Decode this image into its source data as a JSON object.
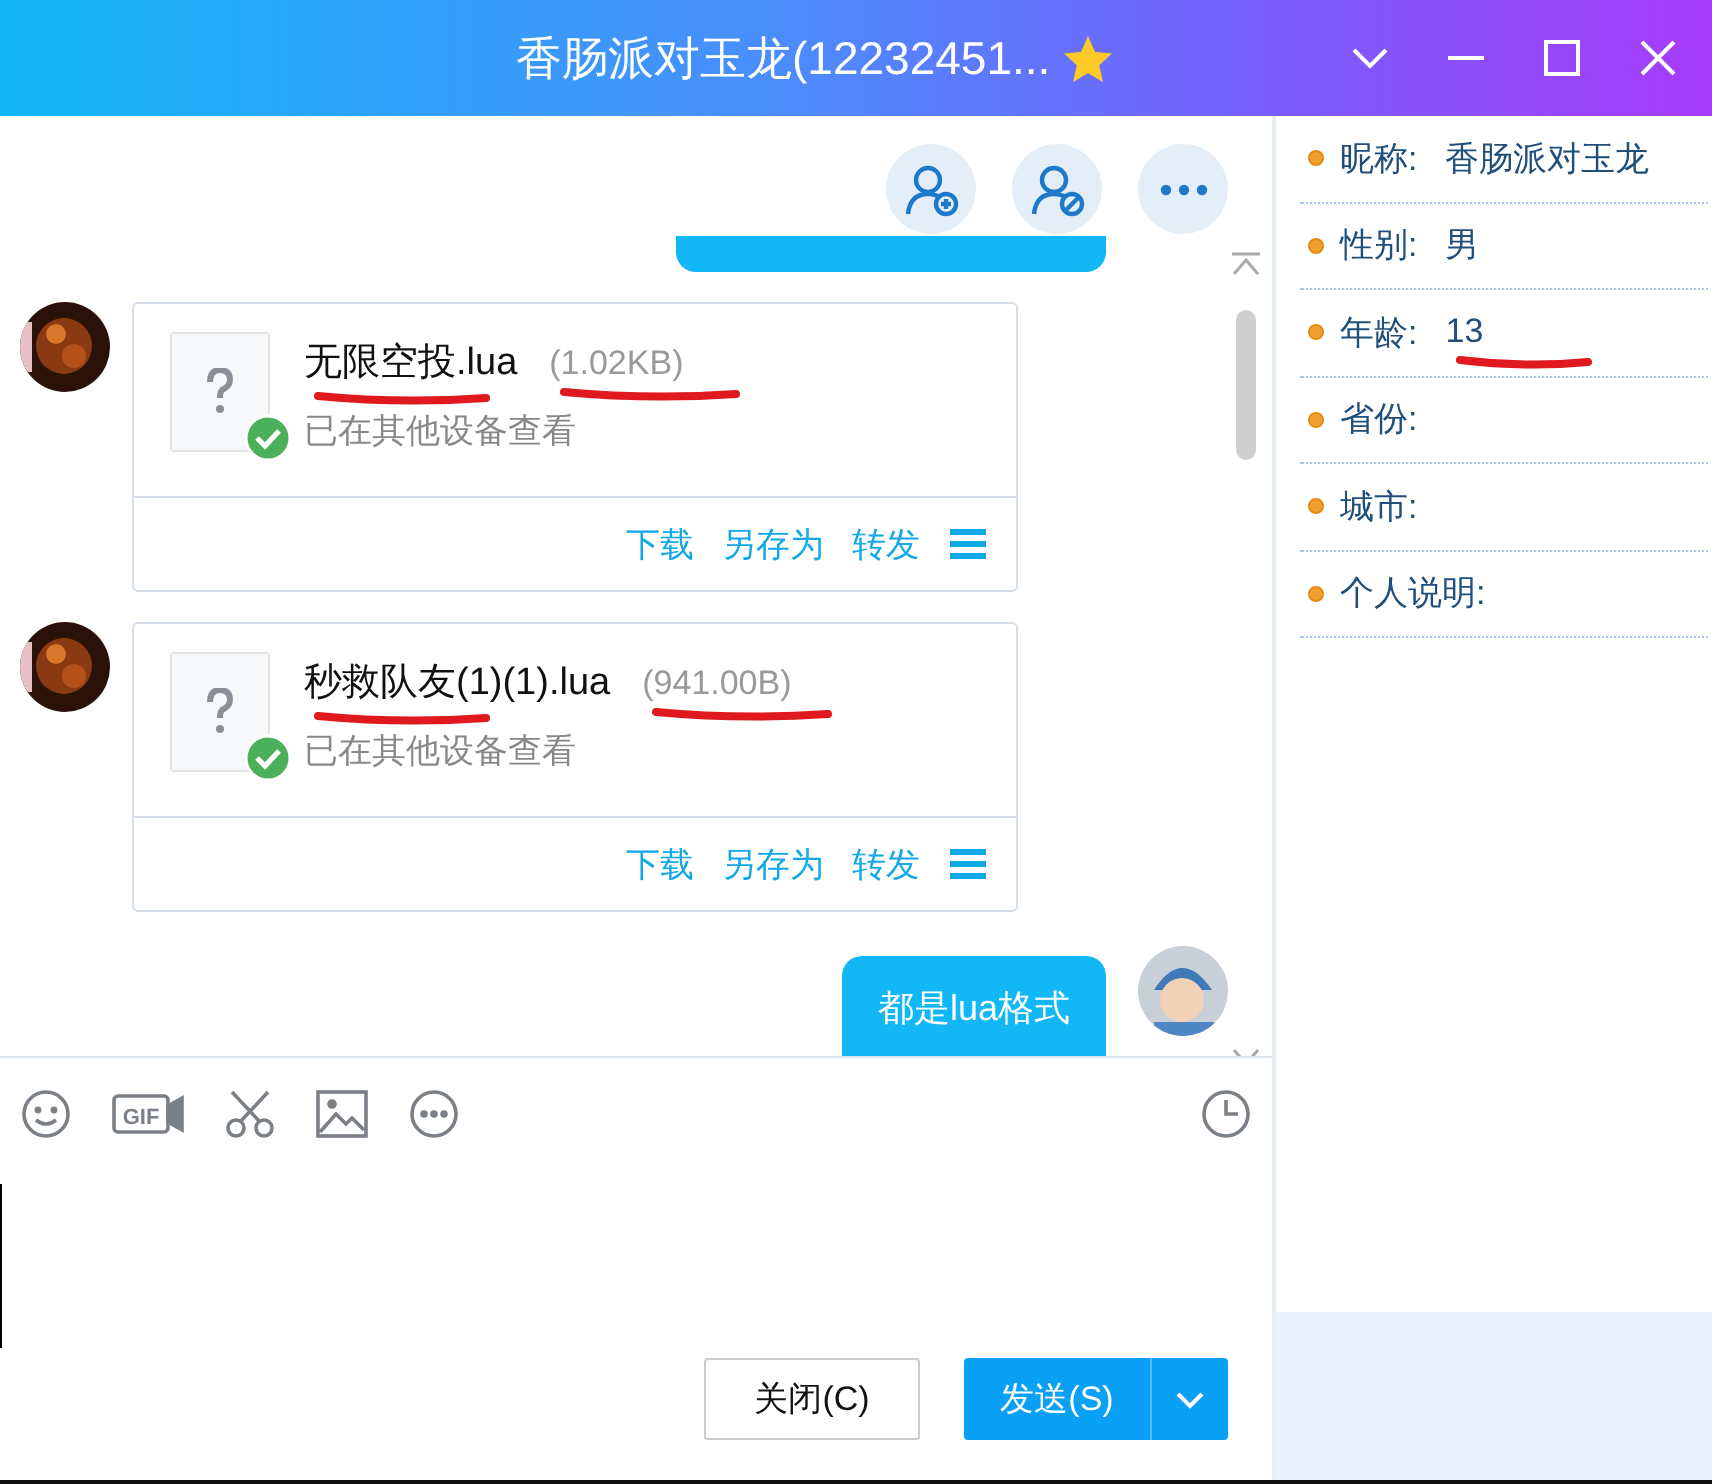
{
  "window": {
    "title": "香肠派对玉龙(12232451..."
  },
  "messages": [
    {
      "kind": "cut_bubble"
    },
    {
      "kind": "file",
      "name": "无限空投.lua",
      "size": "(1.02KB)",
      "status": "已在其他设备查看",
      "name_marked": true,
      "size_marked": true,
      "actions": [
        "下载",
        "另存为",
        "转发"
      ]
    },
    {
      "kind": "file",
      "name": "秒救队友(1)(1).lua",
      "size": "(941.00B)",
      "status": "已在其他设备查看",
      "name_marked": true,
      "size_marked": true,
      "actions": [
        "下载",
        "另存为",
        "转发"
      ]
    },
    {
      "kind": "text",
      "text": "都是lua格式"
    }
  ],
  "profile": [
    {
      "label": "昵称:",
      "value": "香肠派对玉龙",
      "marked": false
    },
    {
      "label": "性别:",
      "value": "男",
      "marked": false
    },
    {
      "label": "年龄:",
      "value": "13",
      "marked": true
    },
    {
      "label": "省份:",
      "marked": false
    },
    {
      "label": "城市:",
      "marked": false
    },
    {
      "label": "个人说明:",
      "marked": false
    }
  ],
  "toolbar": {
    "gif": "GIF"
  },
  "buttons": {
    "close": "关闭(C)",
    "send": "发送(S)"
  }
}
